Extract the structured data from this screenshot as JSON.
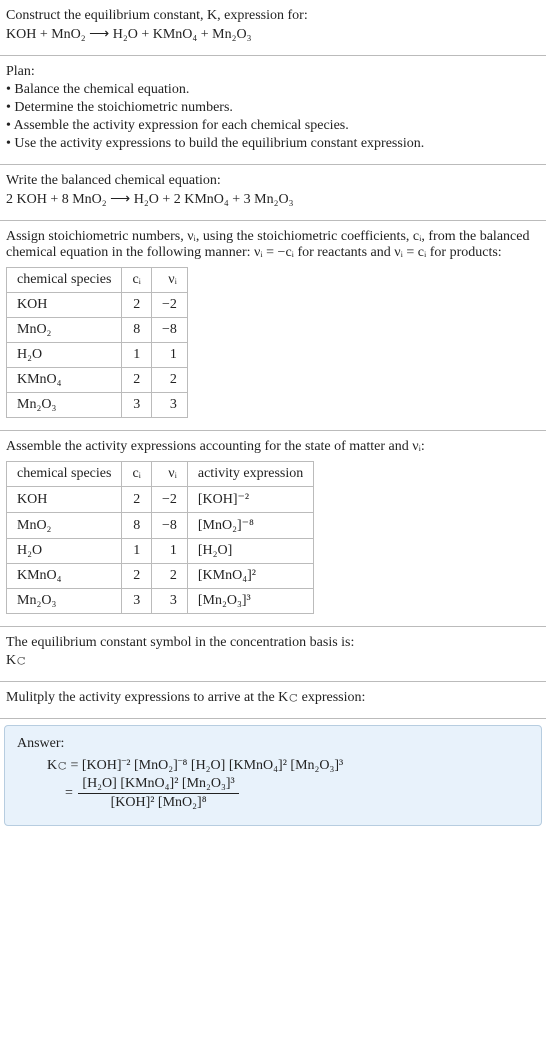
{
  "s1": {
    "l1": "Construct the equilibrium constant, K, expression for:",
    "l2": "KOH + MnO₂ ⟶ H₂O + KMnO₄ + Mn₂O₃"
  },
  "s2": {
    "l1": "Plan:",
    "l2": "• Balance the chemical equation.",
    "l3": "• Determine the stoichiometric numbers.",
    "l4": "• Assemble the activity expression for each chemical species.",
    "l5": "• Use the activity expressions to build the equilibrium constant expression."
  },
  "s3": {
    "l1": "Write the balanced chemical equation:",
    "l2": "2 KOH + 8 MnO₂ ⟶ H₂O + 2 KMnO₄ + 3 Mn₂O₃"
  },
  "s4": {
    "l1": "Assign stoichiometric numbers, νᵢ, using the stoichiometric coefficients, cᵢ, from the balanced chemical equation in the following manner: νᵢ = −cᵢ for reactants and νᵢ = cᵢ for products:"
  },
  "t1": {
    "h": {
      "c0": "chemical species",
      "c1": "cᵢ",
      "c2": "νᵢ"
    },
    "r": [
      {
        "c0": "KOH",
        "c1": "2",
        "c2": "−2"
      },
      {
        "c0": "MnO₂",
        "c1": "8",
        "c2": "−8"
      },
      {
        "c0": "H₂O",
        "c1": "1",
        "c2": "1"
      },
      {
        "c0": "KMnO₄",
        "c1": "2",
        "c2": "2"
      },
      {
        "c0": "Mn₂O₃",
        "c1": "3",
        "c2": "3"
      }
    ]
  },
  "s5": {
    "l1": "Assemble the activity expressions accounting for the state of matter and νᵢ:"
  },
  "t2": {
    "h": {
      "c0": "chemical species",
      "c1": "cᵢ",
      "c2": "νᵢ",
      "c3": "activity expression"
    },
    "r": [
      {
        "c0": "KOH",
        "c1": "2",
        "c2": "−2",
        "c3": "[KOH]⁻²"
      },
      {
        "c0": "MnO₂",
        "c1": "8",
        "c2": "−8",
        "c3": "[MnO₂]⁻⁸"
      },
      {
        "c0": "H₂O",
        "c1": "1",
        "c2": "1",
        "c3": "[H₂O]"
      },
      {
        "c0": "KMnO₄",
        "c1": "2",
        "c2": "2",
        "c3": "[KMnO₄]²"
      },
      {
        "c0": "Mn₂O₃",
        "c1": "3",
        "c2": "3",
        "c3": "[Mn₂O₃]³"
      }
    ]
  },
  "s6": {
    "l1": "The equilibrium constant symbol in the concentration basis is:",
    "l2": "K𝚌"
  },
  "s7": {
    "l1": "Mulitply the activity expressions to arrive at the K𝚌 expression:"
  },
  "ans": {
    "label": "Answer:",
    "line1_lhs": "K𝚌 = ",
    "line1_rhs": "[KOH]⁻² [MnO₂]⁻⁸ [H₂O] [KMnO₄]² [Mn₂O₃]³",
    "line2_eq": "= ",
    "num": "[H₂O] [KMnO₄]² [Mn₂O₃]³",
    "den": "[KOH]² [MnO₂]⁸"
  },
  "chart_data": {
    "type": "table",
    "tables": [
      {
        "name": "stoichiometric-numbers",
        "columns": [
          "chemical species",
          "c_i",
          "v_i"
        ],
        "rows": [
          [
            "KOH",
            2,
            -2
          ],
          [
            "MnO2",
            8,
            -8
          ],
          [
            "H2O",
            1,
            1
          ],
          [
            "KMnO4",
            2,
            2
          ],
          [
            "Mn2O3",
            3,
            3
          ]
        ]
      },
      {
        "name": "activity-expressions",
        "columns": [
          "chemical species",
          "c_i",
          "v_i",
          "activity expression"
        ],
        "rows": [
          [
            "KOH",
            2,
            -2,
            "[KOH]^-2"
          ],
          [
            "MnO2",
            8,
            -8,
            "[MnO2]^-8"
          ],
          [
            "H2O",
            1,
            1,
            "[H2O]"
          ],
          [
            "KMnO4",
            2,
            2,
            "[KMnO4]^2"
          ],
          [
            "Mn2O3",
            3,
            3,
            "[Mn2O3]^3"
          ]
        ]
      }
    ]
  }
}
